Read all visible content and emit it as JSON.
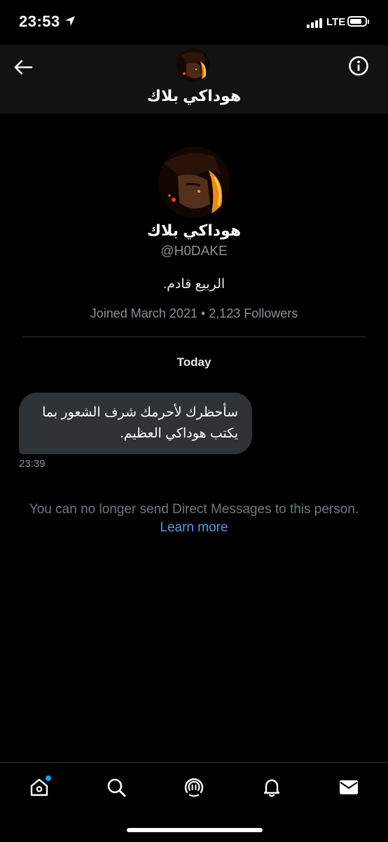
{
  "status_bar": {
    "time": "23:53",
    "network": "LTE",
    "battery_level": 0.8
  },
  "header": {
    "title": "هوداكي بلاك",
    "back_icon": "arrow-left-icon",
    "info_icon": "info-icon"
  },
  "profile": {
    "name": "هوداكي بلاك",
    "handle": "@H0DAKE",
    "bio": "الربيع قادم.",
    "meta": "Joined March 2021 • 2,123 Followers"
  },
  "conversation": {
    "day_label": "Today",
    "messages": [
      {
        "text": "سأحظرك لأحرمك شرف الشعور بما يكتب هوداكي العظيم.",
        "time": "23:39"
      }
    ],
    "notice": "You can no longer send Direct Messages to this person.",
    "learn_more": "Learn more"
  },
  "tab_bar": {
    "items": [
      {
        "icon": "home-icon",
        "has_notification_dot": true
      },
      {
        "icon": "search-icon"
      },
      {
        "icon": "spaces-icon"
      },
      {
        "icon": "bell-icon"
      },
      {
        "icon": "mail-icon"
      }
    ]
  },
  "colors": {
    "background": "#000000",
    "header_bg": "#121212",
    "bubble_bg": "#2f3336",
    "secondary_text": "#8b8f94",
    "link": "#4c9eeb",
    "accent": "#1d9bf0"
  }
}
